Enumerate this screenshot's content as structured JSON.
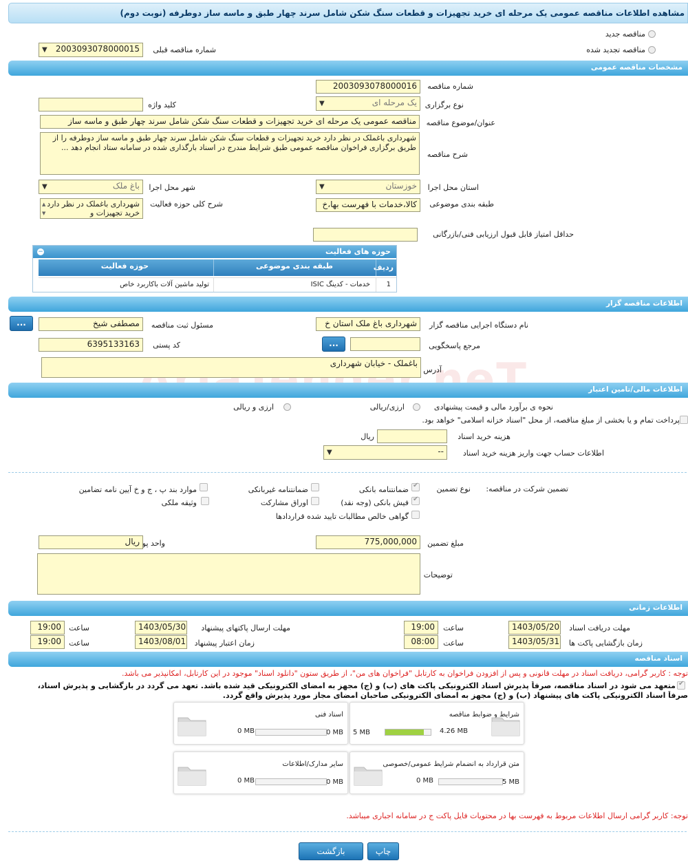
{
  "title": "مشاهده اطلاعات مناقصه عمومی یک مرحله ای خرید تجهیزات و قطعات سنگ شکن شامل سرند چهار طبق و ماسه ساز دوطرفه (نوبت دوم)",
  "top": {
    "new_tender": "مناقصه جدید",
    "renewed_tender": "مناقصه تجدید شده",
    "prev_number_label": "شماره مناقصه قبلی",
    "prev_number": "2003093078000015"
  },
  "sections": {
    "general": "مشخصات مناقصه عمومی",
    "organizer": "اطلاعات مناقصه گزار",
    "finance": "اطلاعات مالی/تامین اعتبار",
    "timing": "اطلاعات زمانی",
    "docs": "اسناد مناقصه"
  },
  "general": {
    "number_label": "شماره مناقصه",
    "number": "2003093078000016",
    "type_label": "نوع برگزاری",
    "type": "یک مرحله ای",
    "keyword_label": "کلید واژه",
    "keyword": "",
    "subject_label": "عنوان/موضوع مناقصه",
    "subject": "مناقصه عمومی یک مرحله ای خرید تجهیزات و قطعات سنگ شکن شامل سرند چهار طبق و ماسه ساز",
    "desc_label": "شرح مناقصه",
    "desc": "شهرداری باغملک در نظر دارد خرید تجهیزات و قطعات سنگ شکن شامل سرند چهار طبق و ماسه ساز دوطرفه را از طریق برگزاری فراخوان مناقصه عمومی طبق شرایط مندرج در اسناد بارگذاری شده در سامانه ستاد انجام دهد ...",
    "province_label": "استان محل اجرا",
    "province": "خوزستان",
    "city_label": "شهر محل اجرا",
    "city": "باغ ملک",
    "category_label": "طبقه بندی موضوعی",
    "category": "کالا،خدمات با فهرست بها،خ",
    "activity_label": "شرح کلی حوزه فعالیت",
    "activity": "شهرداری باغملک در نظر دارد خرید تجهیزات و",
    "min_score_label": "حداقل امتیاز قابل قبول ارزیابی فنی/بازرگانی",
    "min_score": ""
  },
  "activities": {
    "title": "حوزه های فعالیت",
    "headers": [
      "ردیف",
      "طبقه بندی موضوعی",
      "حوزه فعالیت"
    ],
    "rows": [
      [
        "1",
        "خدمات - کدینگ ISIC",
        "تولید ماشین آلات باکاربرد خاص"
      ]
    ]
  },
  "organizer": {
    "org_label": "نام دستگاه اجرایی مناقصه گزار",
    "org": "شهرداری باغ ملک استان خ",
    "officer_label": "مسئول ثبت مناقصه",
    "officer": "مصطفی شیخ",
    "ref_label": "مرجع پاسخگویی",
    "ref": "",
    "postal_label": "کد پستی",
    "postal": "6395133163",
    "address_label": "آدرس",
    "address": "باغملک - خیابان شهرداری",
    "dots": "..."
  },
  "finance": {
    "estimate_label": "نحوه ی برآورد مالی و قیمت پیشنهادی",
    "opt1": "ارزی/ریالی",
    "opt2": "ارزی و ریالی",
    "treasury": "پرداخت تمام و یا بخشی از مبلغ مناقصه، از محل \"اسناد خزانه اسلامی\" خواهد بود.",
    "doc_fee_label": "هزینه خرید اسناد",
    "doc_fee": "",
    "doc_fee_unit": "ریال",
    "account_label": "اطلاعات حساب جهت واریز هزینه خرید اسناد",
    "account": "--"
  },
  "guarantee": {
    "label": "تضمین شرکت در مناقصه:",
    "type_label": "نوع تضمین",
    "bank": "ضمانتنامه بانکی",
    "nonbank": "ضمانتنامه غیربانکی",
    "items_bpj": "موارد بند پ ، ج و خ آیین نامه تضامین",
    "cash": "فیش بانکی (وجه نقد)",
    "bonds": "اوراق مشارکت",
    "property": "وثیقه ملکی",
    "claims": "گواهی خالص مطالبات تایید شده قراردادها",
    "amount_label": "مبلغ تضمین",
    "amount": "775,000,000",
    "currency_label": "واحد پول",
    "currency": "ریال",
    "notes_label": "توضیحات",
    "notes": ""
  },
  "timing": {
    "receive_label": "مهلت دریافت اسناد",
    "receive_date": "1403/05/20",
    "receive_time": "19:00",
    "send_label": "مهلت ارسال پاکتهای پیشنهاد",
    "send_date": "1403/05/30",
    "send_time": "19:00",
    "open_label": "زمان بازگشایی پاکت ها",
    "open_date": "1403/05/31",
    "open_time": "08:00",
    "valid_label": "زمان اعتبار پیشنهاد",
    "valid_date": "1403/08/01",
    "valid_time": "19:00",
    "time_label": "ساعت"
  },
  "docs": {
    "note1": "توجه : کاربر گرامی، دریافت اسناد در مهلت قانونی و پس از افزودن فراخوان به کارتابل \"فراخوان های من\"، از طریق ستون \"دانلود اسناد\" موجود در این کارتابل، امکانپذیر می باشد.",
    "commit1": "متعهد می شود در اسناد مناقصه، صرفاً پذیرش اسناد الکترونیکی پاکت های (ب) و (ج) مجهز به امضای الکترونیکی قید شده باشد. تعهد می گردد در بازگشایی و پذیرش اسناد،",
    "commit2": "صرفاً اسناد الکترونیکی پاکت های پیشنهاد (ب) و (ج) مجهز به امضای الکترونیکی صاحبان امضای مجاز مورد پذیرش واقع گردد.",
    "files": [
      {
        "name": "شرایط و ضوابط مناقصه",
        "used": "4.26 MB",
        "max": "5 MB",
        "pct": 0.85
      },
      {
        "name": "اسناد فنی",
        "used": "0 MB",
        "max": "50 MB",
        "pct": 0
      },
      {
        "name": "متن قرارداد به انضمام شرایط عمومی/خصوصی",
        "used": "0 MB",
        "max": "5 MB",
        "pct": 0
      },
      {
        "name": "سایر مدارک/اطلاعات",
        "used": "0 MB",
        "max": "50 MB",
        "pct": 0
      }
    ],
    "note2": "توجه: کاربر گرامی ارسال اطلاعات مربوط به فهرست بها در محتویات فایل پاکت ج در سامانه اجباری میباشد."
  },
  "buttons": {
    "back": "بازگشت",
    "print": "چاپ"
  },
  "watermark": "AriaTender.neT",
  "colors": {
    "section": "#3fa6dc",
    "field": "#fffbcc",
    "note": "#d22222"
  }
}
